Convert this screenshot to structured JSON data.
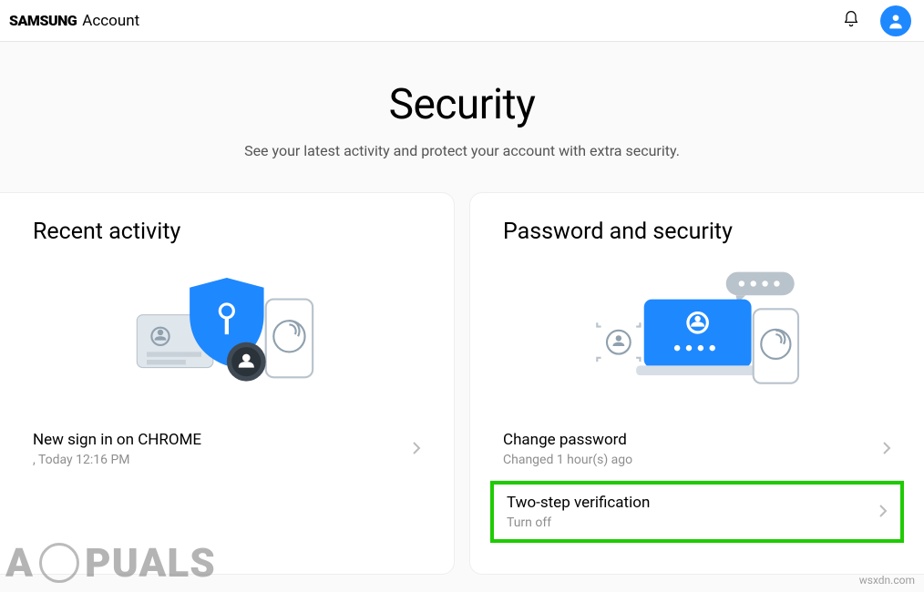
{
  "header": {
    "brand_logo": "SAMSUNG",
    "brand_text": "Account"
  },
  "page": {
    "title": "Security",
    "subtitle": "See your latest activity and protect your account with extra security."
  },
  "recent": {
    "title": "Recent activity",
    "items": [
      {
        "primary": "New sign in on CHROME",
        "secondary": ", Today 12:16 PM"
      }
    ]
  },
  "password": {
    "title": "Password and security",
    "items": [
      {
        "primary": "Change password",
        "secondary": "Changed 1 hour(s) ago"
      },
      {
        "primary": "Two-step verification",
        "secondary": "Turn off"
      }
    ]
  },
  "watermark": {
    "brand_left": "A",
    "brand_right": "PUALS",
    "source": "wsxdn.com"
  },
  "colors": {
    "accent": "#1e88ff",
    "highlight": "#1ecb00"
  }
}
